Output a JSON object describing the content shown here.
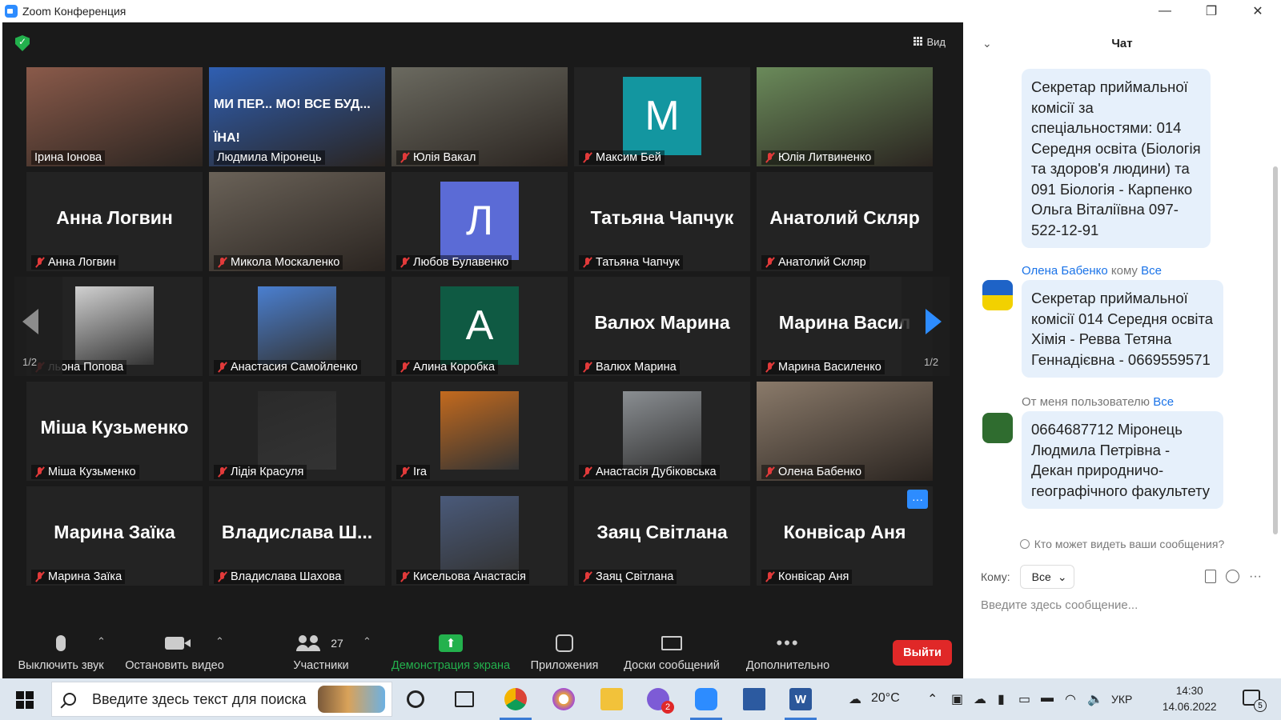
{
  "window": {
    "title": "Zoom Конференция",
    "controls": [
      "—",
      "❐",
      "✕"
    ]
  },
  "meeting": {
    "view_label": "Вид",
    "page_indicator": "1/2",
    "participants": [
      {
        "name": "Ірина Іонова",
        "kind": "video",
        "muted": false,
        "active": true,
        "photo": "#8a5a4a"
      },
      {
        "name": "Людмила Міронець",
        "kind": "video",
        "muted": false,
        "photo": "#2f5fb2",
        "banner": "МИ ПЕР... МО! ВСЕ БУД... ЇНА!"
      },
      {
        "name": "Юлія Вакал",
        "kind": "video",
        "muted": true,
        "photo": "#6b6a60"
      },
      {
        "name": "Максим Бей",
        "kind": "letter",
        "letter": "М",
        "color": "#1396a0",
        "muted": true
      },
      {
        "name": "Юлія Литвиненко",
        "kind": "video",
        "muted": true,
        "photo": "#6a8a5a"
      },
      {
        "name": "Анна Логвин",
        "kind": "name",
        "big": "Анна Логвин",
        "muted": true
      },
      {
        "name": "Микола Москаленко",
        "kind": "video",
        "muted": true,
        "photo": "#6a6258"
      },
      {
        "name": "Любов Булавенко",
        "kind": "letter",
        "letter": "Л",
        "color": "#5b6bd6",
        "muted": true
      },
      {
        "name": "Татьяна Чапчук",
        "kind": "name",
        "big": "Татьяна Чапчук",
        "muted": true
      },
      {
        "name": "Анатолий  Скляр",
        "kind": "name",
        "big": "Анатолий  Скляр",
        "muted": true
      },
      {
        "name": "льона Попова",
        "kind": "avatar",
        "muted": true,
        "photo": "#d0d0d0"
      },
      {
        "name": "Анастасия Самойленко",
        "kind": "avatar",
        "muted": true,
        "photo": "#4a7fd0"
      },
      {
        "name": "Алина Коробка",
        "kind": "letter",
        "letter": "А",
        "color": "#0f5a43",
        "muted": true
      },
      {
        "name": "Валюх Марина",
        "kind": "name",
        "big": "Валюх Марина",
        "muted": true
      },
      {
        "name": "Марина Василенко",
        "kind": "name",
        "big": "Марина  Васил",
        "muted": true
      },
      {
        "name": "Міша Кузьменко",
        "kind": "name",
        "big": "Міша Кузьменко",
        "muted": true
      },
      {
        "name": "Лідія Красуля",
        "kind": "avatar",
        "muted": true,
        "photo": "#2a2a2a"
      },
      {
        "name": "Ira",
        "kind": "avatar",
        "muted": true,
        "photo": "#c36a1e"
      },
      {
        "name": "Анастасія Дубіковська",
        "kind": "avatar",
        "muted": true,
        "photo": "#8a8e92"
      },
      {
        "name": "Олена Бабенко",
        "kind": "video",
        "muted": true,
        "photo": "#8a7a6a"
      },
      {
        "name": "Марина Заїка",
        "kind": "name",
        "big": "Марина Заїка",
        "muted": true
      },
      {
        "name": "Владислава Шахова",
        "kind": "name",
        "big": "Владислава  Ш...",
        "muted": true
      },
      {
        "name": "Кисельова Анастасія",
        "kind": "avatar",
        "muted": true,
        "photo": "#4a5a7a"
      },
      {
        "name": "Заяц Світлана",
        "kind": "name",
        "big": "Заяц Світлана",
        "muted": true
      },
      {
        "name": "Конвісар Аня",
        "kind": "name",
        "big": "Конвісар Аня",
        "muted": true,
        "more": "···"
      }
    ]
  },
  "toolbar": {
    "mute": "Выключить звук",
    "video": "Остановить видео",
    "participants": "Участники",
    "participants_count": "27",
    "share": "Демонстрация экрана",
    "apps": "Приложения",
    "whiteboards": "Доски сообщений",
    "more": "Дополнительно",
    "leave": "Выйти",
    "share_color": "#23b14d",
    "leave_color": "#e02828"
  },
  "chat": {
    "title": "Чат",
    "messages": [
      {
        "text": "Секретар приймальної комісії за спеціальностями: 014 Середня освіта (Біологія та здоров'я людини) та 091 Біологія - Карпенко Ольга Віталіївна 097-522-12-91"
      },
      {
        "sender": "Олена Бабенко",
        "to_word": "кому",
        "recipient": "Все",
        "text": "Секретар приймальної комісії 014 Середня освіта Хімія - Ревва Тетяна Геннадієвна - 0669559571"
      },
      {
        "sender_prefix": "От меня пользователю",
        "recipient": "Все",
        "text": "0664687712 Міронець Людмила Петрівна - Декан природничо-географічного факультету"
      }
    ],
    "who_sees": "Кто может видеть ваши сообщения?",
    "to_label": "Кому:",
    "to_value": "Все",
    "input_placeholder": "Введите здесь сообщение..."
  },
  "taskbar": {
    "search_placeholder": "Введите здесь текст для поиска",
    "temperature": "20°C",
    "language": "УКР",
    "time": "14:30",
    "date": "14.06.2022",
    "viber_badge": "2",
    "notification_count": "5"
  }
}
